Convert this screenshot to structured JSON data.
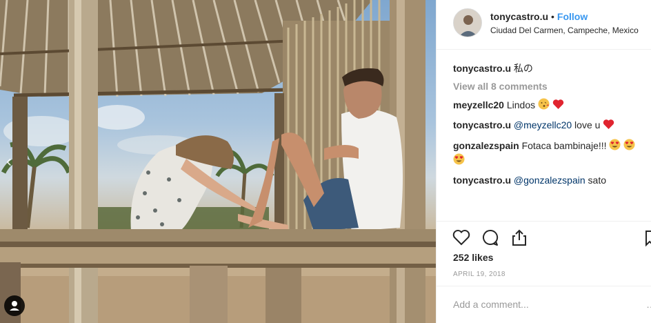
{
  "post": {
    "username": "tonycastro.u",
    "follow_label": "Follow",
    "separator": "•",
    "location": "Ciudad Del Carmen, Campeche, Mexico"
  },
  "caption": {
    "user": "tonycastro.u",
    "text": "私の"
  },
  "view_all_label": "View all 8 comments",
  "comments": [
    {
      "user": "meyzellc20",
      "text": "Lindos",
      "emojis": [
        "kiss-face",
        "red-heart"
      ]
    },
    {
      "user": "tonycastro.u",
      "mention": "@meyzellc20",
      "text": "love u",
      "emojis": [
        "red-heart"
      ]
    },
    {
      "user": "gonzalezspain",
      "text": "Fotaca bambinaje!!!",
      "emojis": [
        "heart-eyes",
        "heart-eyes",
        "heart-eyes"
      ]
    },
    {
      "user": "tonycastro.u",
      "mention": "@gonzalezspain",
      "text": "sato"
    }
  ],
  "likes_label": "252 likes",
  "date_label": "APRIL 19, 2018",
  "comment_placeholder": "Add a comment...",
  "more_label": "…",
  "colors": {
    "accent": "#3897f0",
    "mention": "#003569",
    "muted": "#999999",
    "text": "#262626",
    "border": "#efefef"
  },
  "icons": [
    "heart-icon",
    "comment-icon",
    "share-icon",
    "bookmark-icon",
    "tag-people-icon",
    "chevron-left-icon"
  ]
}
